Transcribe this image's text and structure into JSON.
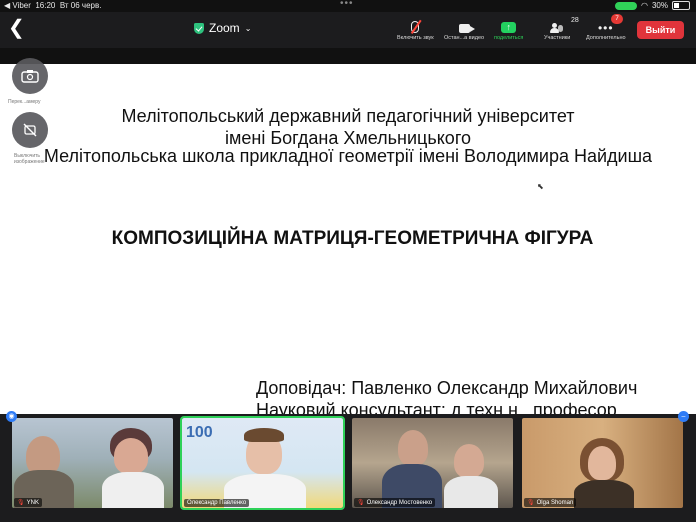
{
  "status_bar": {
    "carrier": "◀ Viber",
    "time": "16:20",
    "date": "Вт 06 черв.",
    "battery": "30%"
  },
  "top_bar": {
    "meeting_title": "Zoom",
    "controls": {
      "audio_label": "Включить звук",
      "video_label": "Остан...а видео",
      "share_label": "поделиться",
      "participants_label": "Участники",
      "participants_count": "28",
      "more_label": "Дополнительно",
      "more_badge": "7"
    },
    "leave_label": "Выйти"
  },
  "floating": {
    "switch_label": "Перек...амеру",
    "mute_label": "Выключить изображение"
  },
  "slide": {
    "line1": "Мелітопольський державний педагогічний університет",
    "line2": "імені Богдана Хмельницького",
    "line3": "Мелітопольська школа прикладної геометрії імені Володимира Найдиша",
    "title": "КОМПОЗИЦІЙНА МАТРИЦЯ-ГЕОМЕТРИЧНА ФІГУРА",
    "speaker": "Доповідач: Павленко Олександр Михайлович",
    "consultant": "Науковий консультант: д.техн.н., професор"
  },
  "participants": [
    {
      "name": "YNK",
      "muted": true
    },
    {
      "name": "Олександр Павленко",
      "muted": false
    },
    {
      "name": "Олександр Мостовенко",
      "muted": true
    },
    {
      "name": "Olga Shoman",
      "muted": true
    }
  ],
  "colors": {
    "accent_green": "#2ed158",
    "leave_red": "#e0343b",
    "toolbar_bg": "#1c1c1e"
  }
}
